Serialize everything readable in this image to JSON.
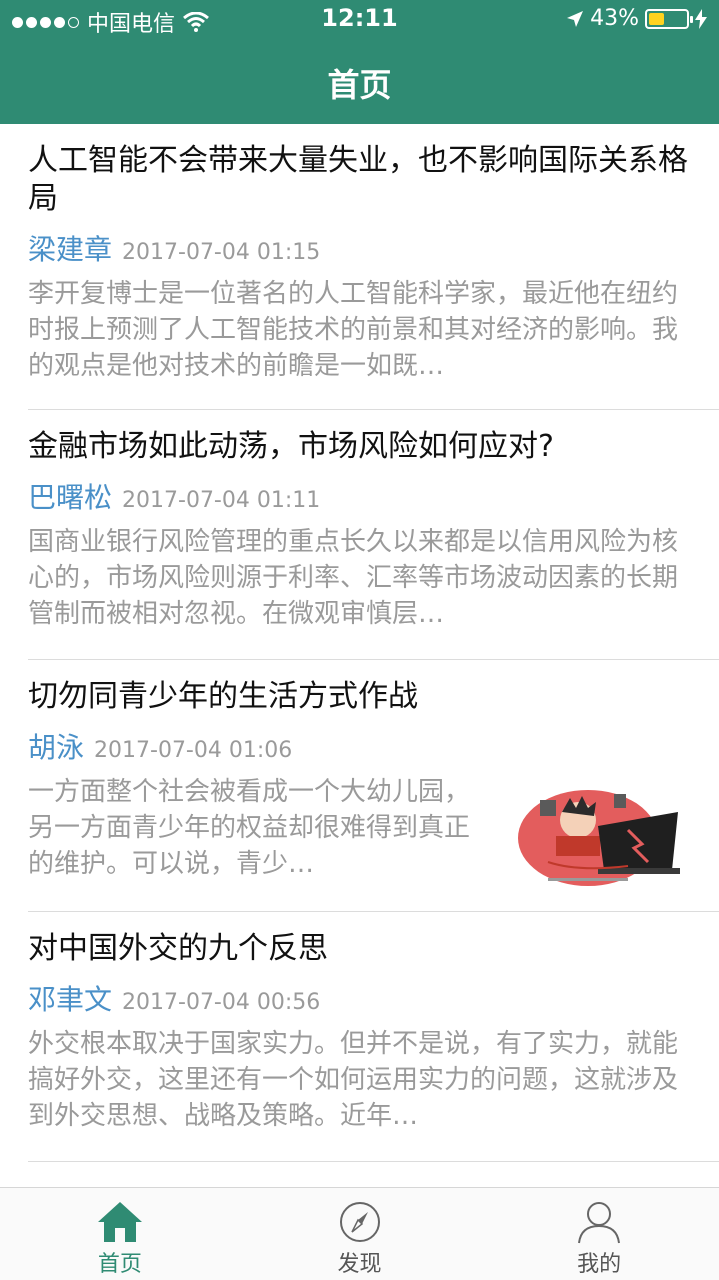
{
  "status": {
    "carrier": "中国电信",
    "time": "12:11",
    "battery": "43%",
    "battery_level": 0.43
  },
  "header": {
    "title": "首页"
  },
  "articles": [
    {
      "title": "人工智能不会带来大量失业，也不影响国际关系格局",
      "author": "梁建章",
      "date": "2017-07-04 01:15",
      "summary": "李开复博士是一位著名的人工智能科学家，最近他在纽约时报上预测了人工智能技术的前景和其对经济的影响。我的观点是他对技术的前瞻是一如既…",
      "has_image": false
    },
    {
      "title": "金融市场如此动荡，市场风险如何应对?",
      "author": "巴曙松",
      "date": "2017-07-04 01:11",
      "summary": "国商业银行风险管理的重点长久以来都是以信用风险为核心的，市场风险则源于利率、汇率等市场波动因素的长期管制而被相对忽视。在微观审慎层…",
      "has_image": false
    },
    {
      "title": "切勿同青少年的生活方式作战",
      "author": "胡泳",
      "date": "2017-07-04 01:06",
      "summary": "一方面整个社会被看成一个大幼儿园，另一方面青少年的权益却很难得到真正的维护。可以说，青少…",
      "has_image": true
    },
    {
      "title": "对中国外交的九个反思",
      "author": "邓聿文",
      "date": "2017-07-04 00:56",
      "summary": "外交根本取决于国家实力。但并不是说，有了实力，就能搞好外交，这里还有一个如何运用实力的问题，这就涉及到外交思想、战略及策略。近年…",
      "has_image": false
    }
  ],
  "tabbar": {
    "tabs": [
      {
        "label": "首页",
        "icon": "home-icon",
        "active": true
      },
      {
        "label": "发现",
        "icon": "compass-icon",
        "active": false
      },
      {
        "label": "我的",
        "icon": "person-icon",
        "active": false
      }
    ]
  },
  "colors": {
    "accent": "#2f8b73",
    "author": "#4a90c8",
    "muted": "#9a9a9a"
  }
}
